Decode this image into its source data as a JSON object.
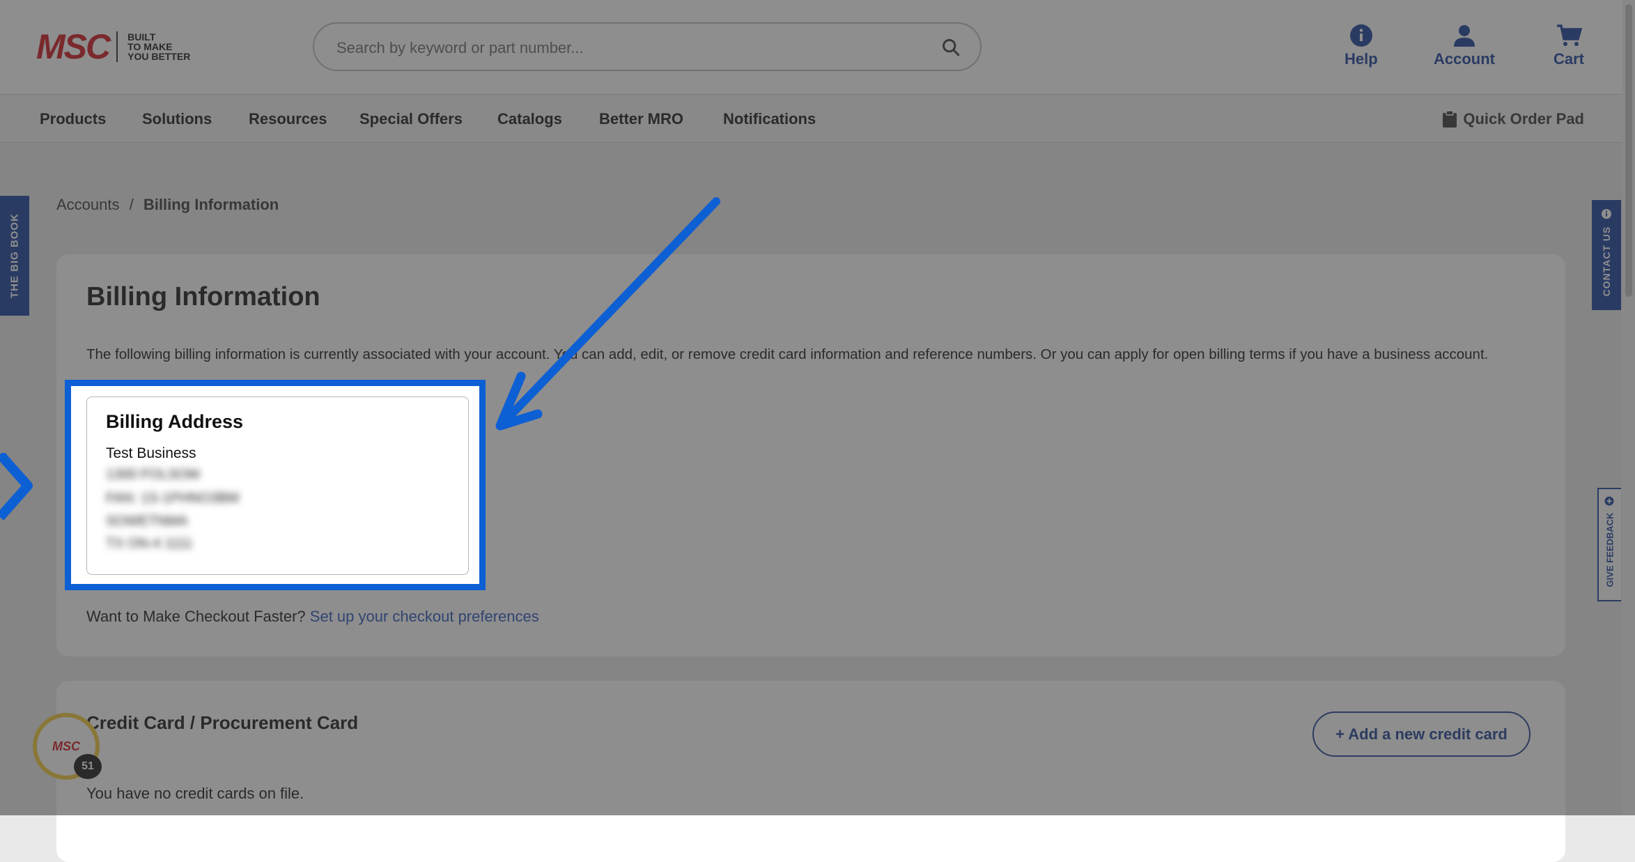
{
  "header": {
    "logo_text": "MSC",
    "logo_tagline": [
      "BUILT",
      "TO MAKE",
      "YOU BETTER"
    ],
    "search_placeholder": "Search by keyword or part number...",
    "help_label": "Help",
    "account_label": "Account",
    "cart_label": "Cart"
  },
  "nav": {
    "items": [
      "Products",
      "Solutions",
      "Resources",
      "Special Offers",
      "Catalogs",
      "Better MRO",
      "Notifications"
    ],
    "quick_order": "Quick Order Pad"
  },
  "breadcrumb": {
    "parent": "Accounts",
    "separator": "/",
    "current": "Billing Information"
  },
  "billing": {
    "title": "Billing Information",
    "description": "The following billing information is currently associated with your account. You can add, edit, or remove credit card information and reference numbers. Or you can apply for open billing terms if you have a business account.",
    "address_title": "Billing Address",
    "address_name": "Test Business",
    "address_lines_redacted": [
      "1300 FOLSOM",
      "FAN: 1S-1PHNO3BM",
      "SOWETNMA",
      "TX ON-4 1111"
    ],
    "checkout_prompt": "Want to Make Checkout Faster?",
    "checkout_link": "Set up your checkout preferences"
  },
  "credit_card": {
    "title": "Credit Card / Procurement Card",
    "add_button": "+ Add a new credit card",
    "empty_text": "You have no credit cards on file."
  },
  "side_tabs": {
    "left": "THE BIG BOOK",
    "right": "CONTACT US",
    "feedback": "GIVE FEEDBACK"
  },
  "badge": {
    "logo": "MSC",
    "count": "51"
  },
  "colors": {
    "brand_red": "#d0101a",
    "brand_blue": "#123a9a",
    "highlight": "#0d5fd4"
  }
}
